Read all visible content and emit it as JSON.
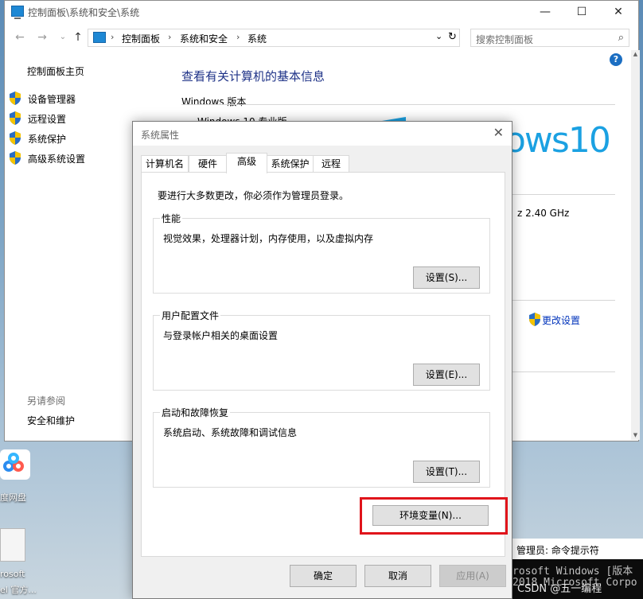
{
  "control_panel": {
    "title": "控制面板\\系统和安全\\系统",
    "window_controls": {
      "minimize": "—",
      "maximize": "☐",
      "close": "✕"
    },
    "nav": {
      "back": "←",
      "forward": "→",
      "up": "↑",
      "dropdown": "⌄",
      "refresh": "↻"
    },
    "breadcrumbs": [
      "控制面板",
      "系统和安全",
      "系统"
    ],
    "breadcrumb_sep": "›",
    "search_placeholder": "搜索控制面板",
    "left_nav": {
      "home": "控制面板主页",
      "items": [
        "设备管理器",
        "远程设置",
        "系统保护",
        "高级系统设置"
      ],
      "see_also": "另请参阅",
      "security": "安全和维护"
    },
    "main": {
      "heading": "查看有关计算机的基本信息",
      "windows_version_label": "Windows 版本",
      "edition": "Windows 10 专业版",
      "logo_text": "ows10",
      "cpu_speed": "z  2.40 GHz",
      "change_settings": "更改设置"
    },
    "help": "?"
  },
  "cmd": {
    "title": "管理员: 命令提示符",
    "lines": [
      "rosoft Windows [版本",
      "2018 Microsoft Corpo"
    ],
    "watermark": "CSDN @五一编程"
  },
  "desktop": {
    "icons": [
      "度网盘",
      "rosoft",
      "el 官方..."
    ]
  },
  "dialog": {
    "title": "系统属性",
    "close": "✕",
    "tabs": [
      "计算机名",
      "硬件",
      "高级",
      "系统保护",
      "远程"
    ],
    "active_tab": 2,
    "note": "要进行大多数更改，你必须作为管理员登录。",
    "groups": [
      {
        "title": "性能",
        "desc": "视觉效果，处理器计划，内存使用，以及虚拟内存",
        "button": "设置(S)..."
      },
      {
        "title": "用户配置文件",
        "desc": "与登录帐户相关的桌面设置",
        "button": "设置(E)..."
      },
      {
        "title": "启动和故障恢复",
        "desc": "系统启动、系统故障和调试信息",
        "button": "设置(T)..."
      }
    ],
    "env_button": "环境变量(N)...",
    "ok": "确定",
    "cancel": "取消",
    "apply": "应用(A)",
    "highlight_color": "#e0141b"
  }
}
